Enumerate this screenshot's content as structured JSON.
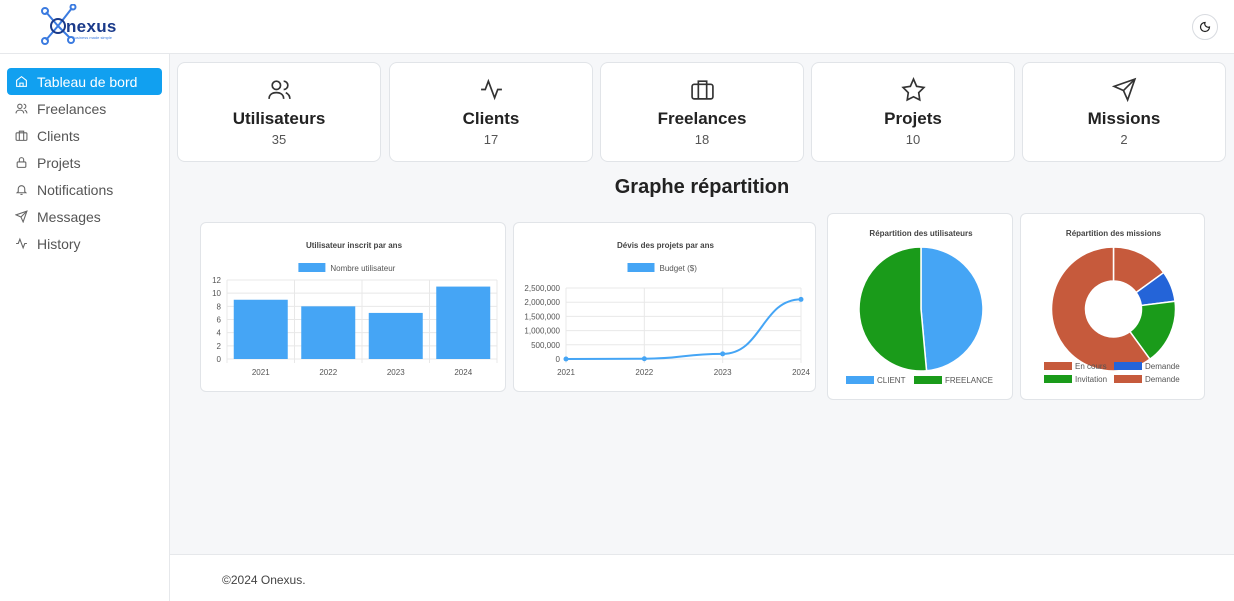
{
  "brand": {
    "name": "nexus",
    "tagline": "Business made simple"
  },
  "sidebar": {
    "items": [
      {
        "label": "Tableau de bord",
        "icon": "home-icon",
        "active": true
      },
      {
        "label": "Freelances",
        "icon": "users-icon"
      },
      {
        "label": "Clients",
        "icon": "briefcase-icon"
      },
      {
        "label": "Projets",
        "icon": "lock-icon"
      },
      {
        "label": "Notifications",
        "icon": "bell-icon"
      },
      {
        "label": "Messages",
        "icon": "send-icon"
      },
      {
        "label": "History",
        "icon": "activity-icon"
      }
    ]
  },
  "stats": [
    {
      "title": "Utilisateurs",
      "value": "35",
      "icon": "users-icon"
    },
    {
      "title": "Clients",
      "value": "17",
      "icon": "activity-icon"
    },
    {
      "title": "Freelances",
      "value": "18",
      "icon": "briefcase-icon"
    },
    {
      "title": "Projets",
      "value": "10",
      "icon": "star-icon"
    },
    {
      "title": "Missions",
      "value": "2",
      "icon": "send-icon"
    }
  ],
  "section_title": "Graphe répartition",
  "footer": "©2024 Onexus.",
  "colors": {
    "accent": "#11a0f0",
    "bar": "#45a5f5",
    "green": "#1a9b1a",
    "rust": "#c65a3c",
    "blue": "#2464d8"
  },
  "chart_data": [
    {
      "type": "bar",
      "title": "Utilisateur inscrit par ans",
      "legend": [
        "Nombre utilisateur"
      ],
      "categories": [
        "2021",
        "2022",
        "2023",
        "2024"
      ],
      "values": [
        9,
        8,
        7,
        11
      ],
      "ylim": [
        0,
        12
      ],
      "yticks": [
        "0",
        "2",
        "4",
        "6",
        "8",
        "10",
        "12"
      ],
      "grid": true,
      "legend_position": "top"
    },
    {
      "type": "line",
      "title": "Dévis des projets par ans",
      "legend": [
        "Budget ($)"
      ],
      "categories": [
        "2021",
        "2022",
        "2023",
        "2024"
      ],
      "values": [
        0,
        10000,
        180000,
        2100000
      ],
      "ylim": [
        0,
        2500000
      ],
      "yticks": [
        "0",
        "500,000",
        "1,000,000",
        "1,500,000",
        "2,000,000",
        "2,500,000"
      ],
      "grid": true,
      "legend_position": "top"
    },
    {
      "type": "pie",
      "title": "Répartition des utilisateurs",
      "labels": [
        "CLIENT",
        "FREELANCE"
      ],
      "values": [
        17,
        18
      ],
      "colors": [
        "#45a5f5",
        "#1a9b1a"
      ],
      "legend_position": "bottom"
    },
    {
      "type": "pie",
      "title": "Répartition des missions",
      "labels": [
        "En cours",
        "Demande",
        "Invitation",
        "Demande"
      ],
      "values": [
        15,
        8,
        17,
        60
      ],
      "colors": [
        "#c65a3c",
        "#2464d8",
        "#1a9b1a",
        "#c65a3c"
      ],
      "legend_position": "bottom"
    }
  ]
}
